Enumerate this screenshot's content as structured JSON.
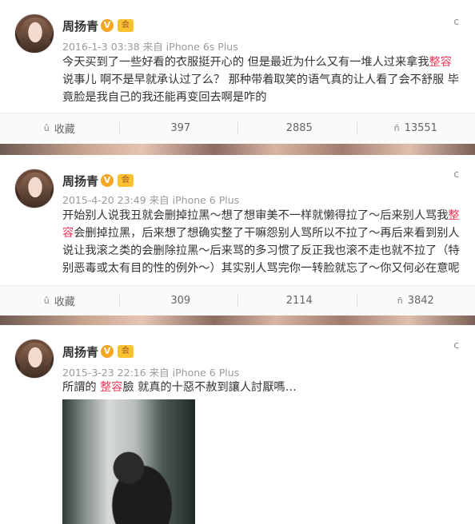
{
  "posts": [
    {
      "name": "周扬青",
      "badge_v": "V",
      "badge_member": "会",
      "meta": "2016-1-3 03:38 来自 iPhone 6s Plus",
      "menu": "c",
      "text_parts": [
        "今天买到了一些好看的衣服挺开心的 但是最近为什么又有一堆人过来拿我",
        "整容",
        "说事儿 啊不是早就承认过了么？ 那种带着取笑的语气真的让人看了会不舒服 毕竟脸是我自己的我还能再变回去啊是咋的"
      ],
      "toolbar": {
        "fav_icon": "û",
        "fav_label": "收藏",
        "share_icon": "",
        "share_count": "397",
        "comment_icon": "",
        "comment_count": "2885",
        "like_icon": "ñ",
        "like_count": "13551"
      }
    },
    {
      "name": "周扬青",
      "badge_v": "V",
      "badge_member": "会",
      "meta": "2015-4-20 23:49 来自 iPhone 6 Plus",
      "menu": "c",
      "text_parts": [
        "开始别人说我丑就会删掉拉黑～想了想审美不一样就懒得拉了～后来别人骂我",
        "整容",
        "会删掉拉黑，后来想了想确实整了干嘛怨别人骂所以不拉了～再后来看到别人说让我滚之类的会删除拉黑～后来骂的多习惯了反正我也滚不走也就不拉了（特别恶毒或太有目的性的例外～）其实别人骂完你一转脸就忘了～你又何必在意呢"
      ],
      "toolbar": {
        "fav_icon": "û",
        "fav_label": "收藏",
        "share_icon": "",
        "share_count": "309",
        "comment_icon": "",
        "comment_count": "2114",
        "like_icon": "ñ",
        "like_count": "3842"
      }
    },
    {
      "name": "周扬青",
      "badge_v": "V",
      "badge_member": "会",
      "meta": "2015-3-23 22:16 来自 iPhone 6 Plus",
      "menu": "c",
      "text_parts": [
        "所謂的 ",
        "整容",
        "臉 就真的十惡不赦到讓人討厭嗎…"
      ]
    }
  ],
  "colors": {
    "highlight": "#eb3b5a",
    "meta": "#9a9a9a",
    "badge_v": "#f5a623"
  }
}
